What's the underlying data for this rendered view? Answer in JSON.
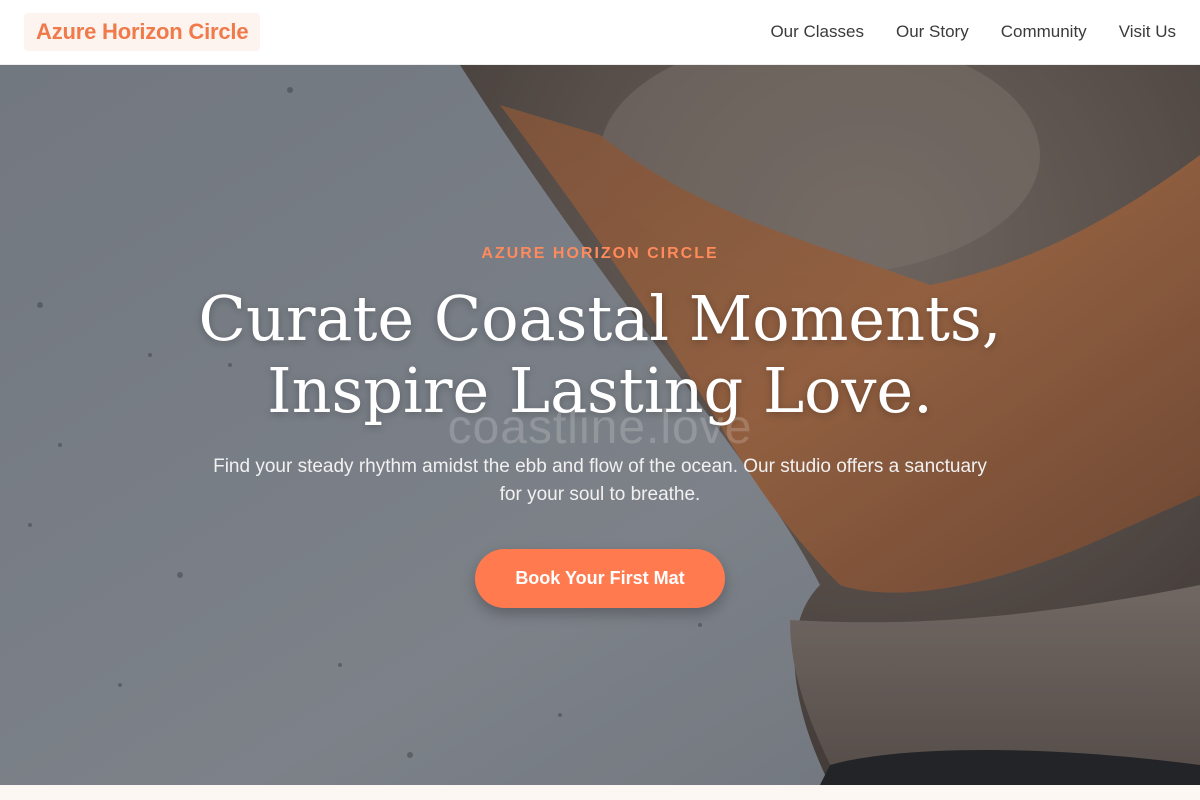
{
  "header": {
    "logo": "Azure Horizon Circle",
    "nav": [
      "Our Classes",
      "Our Story",
      "Community",
      "Visit Us"
    ]
  },
  "hero": {
    "eyebrow": "AZURE HORIZON CIRCLE",
    "headline_line1": "Curate Coastal Moments,",
    "headline_line2": "Inspire Lasting Love.",
    "watermark": "coastline.love",
    "subtext": "Find your steady rhythm amidst the ebb and flow of the ocean. Our studio offers a sanctuary for your soul to breathe.",
    "cta_label": "Book Your First Mat"
  },
  "colors": {
    "accent": "#ff7b4f",
    "logo_text": "#f07a4a",
    "logo_bg": "#fdf3ef"
  }
}
